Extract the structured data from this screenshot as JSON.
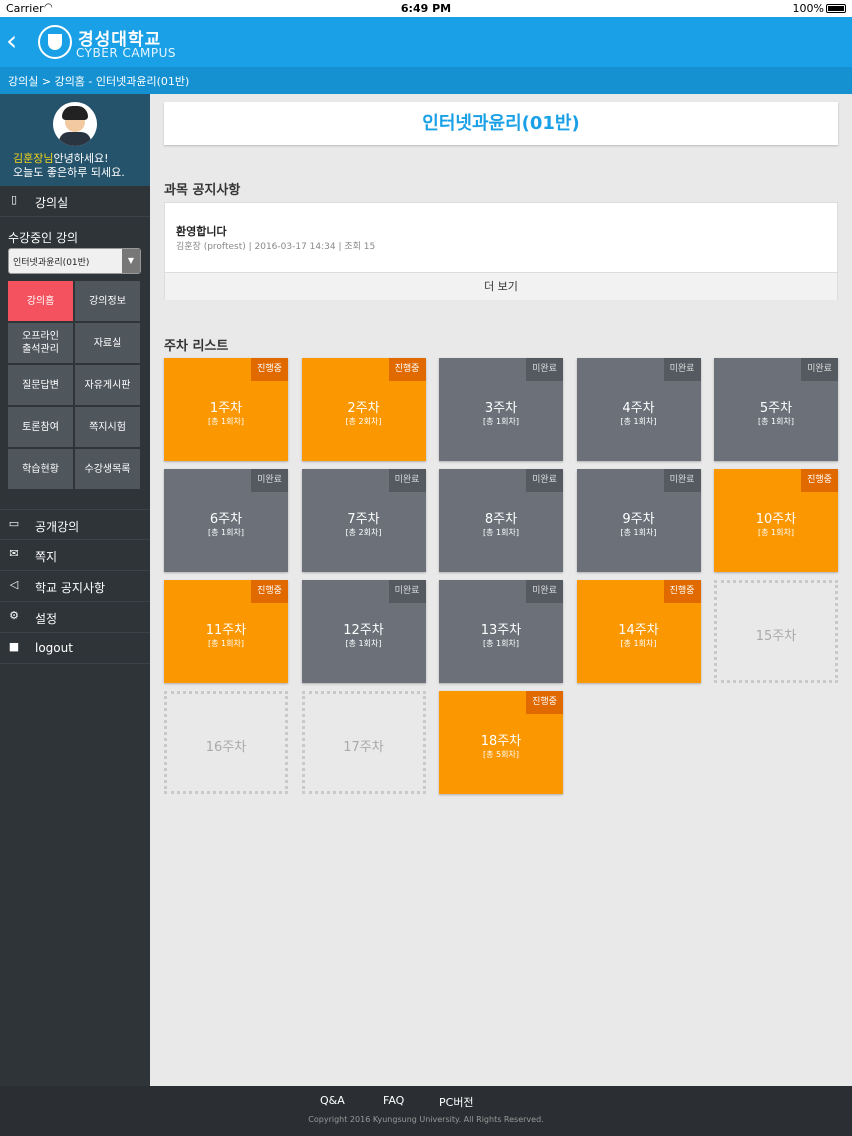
{
  "status_bar": {
    "carrier": "Carrier",
    "time": "6:49 PM",
    "battery": "100%"
  },
  "header": {
    "logo_title": "경성대학교",
    "logo_subtitle": "CYBER CAMPUS"
  },
  "breadcrumb": "강의실 > 강의홈 - 인터넷과윤리(01반)",
  "sidebar": {
    "user_name": "김훈장님",
    "greeting_suffix": "안녕하세요!",
    "greeting_line2": "오늘도 좋은하루 되세요.",
    "classroom_label": "강의실",
    "current_courses_label": "수강중인 강의",
    "selected_course": "인터넷과윤리(01반)",
    "grid": [
      {
        "label": "강의홈",
        "active": true
      },
      {
        "label": "강의정보",
        "active": false
      },
      {
        "label": "오프라인\n출석관리",
        "active": false
      },
      {
        "label": "자료실",
        "active": false
      },
      {
        "label": "질문답변",
        "active": false
      },
      {
        "label": "자유게시판",
        "active": false
      },
      {
        "label": "토론참여",
        "active": false
      },
      {
        "label": "쪽지시험",
        "active": false
      },
      {
        "label": "학습현황",
        "active": false
      },
      {
        "label": "수강생목록",
        "active": false
      }
    ],
    "menu": [
      {
        "label": "공개강의",
        "icon": "folder-icon"
      },
      {
        "label": "쪽지",
        "icon": "envelope-icon"
      },
      {
        "label": "학교 공지사항",
        "icon": "speaker-icon"
      },
      {
        "label": "설정",
        "icon": "gear-icon"
      },
      {
        "label": "logout",
        "icon": "lock-icon"
      }
    ]
  },
  "main": {
    "course_title": "인터넷과윤리(01반)",
    "notice_section_title": "과목 공지사항",
    "notice": {
      "title": "환영합니다",
      "meta": "김훈장 (proftest) | 2016-03-17 14:34 | 조회 15"
    },
    "more_label": "더 보기",
    "weeks_section_title": "주차 리스트",
    "weeks": [
      {
        "label": "1주차",
        "sub": "[총 1회차]",
        "status": "진행중",
        "state": "orange"
      },
      {
        "label": "2주차",
        "sub": "[총 2회차]",
        "status": "진행중",
        "state": "orange"
      },
      {
        "label": "3주차",
        "sub": "[총 1회차]",
        "status": "미완료",
        "state": "gray"
      },
      {
        "label": "4주차",
        "sub": "[총 1회차]",
        "status": "미완료",
        "state": "gray"
      },
      {
        "label": "5주차",
        "sub": "[총 1회차]",
        "status": "미완료",
        "state": "gray"
      },
      {
        "label": "6주차",
        "sub": "[총 1회차]",
        "status": "미완료",
        "state": "gray"
      },
      {
        "label": "7주차",
        "sub": "[총 2회차]",
        "status": "미완료",
        "state": "gray"
      },
      {
        "label": "8주차",
        "sub": "[총 1회차]",
        "status": "미완료",
        "state": "gray"
      },
      {
        "label": "9주차",
        "sub": "[총 1회차]",
        "status": "미완료",
        "state": "gray"
      },
      {
        "label": "10주차",
        "sub": "[총 1회차]",
        "status": "진행중",
        "state": "orange"
      },
      {
        "label": "11주차",
        "sub": "[총 1회차]",
        "status": "진행중",
        "state": "orange"
      },
      {
        "label": "12주차",
        "sub": "[총 1회차]",
        "status": "미완료",
        "state": "gray"
      },
      {
        "label": "13주차",
        "sub": "[총 1회차]",
        "status": "미완료",
        "state": "gray"
      },
      {
        "label": "14주차",
        "sub": "[총 1회차]",
        "status": "진행중",
        "state": "orange"
      },
      {
        "label": "15주차",
        "sub": "",
        "status": "",
        "state": "empty"
      },
      {
        "label": "16주차",
        "sub": "",
        "status": "",
        "state": "empty"
      },
      {
        "label": "17주차",
        "sub": "",
        "status": "",
        "state": "empty"
      },
      {
        "label": "18주차",
        "sub": "[총 5회차]",
        "status": "진행중",
        "state": "orange"
      }
    ]
  },
  "footer": {
    "links": [
      "Q&A",
      "FAQ",
      "PC버전"
    ],
    "copyright": "Copyright 2016 Kyungsung University. All Rights Reserved."
  }
}
